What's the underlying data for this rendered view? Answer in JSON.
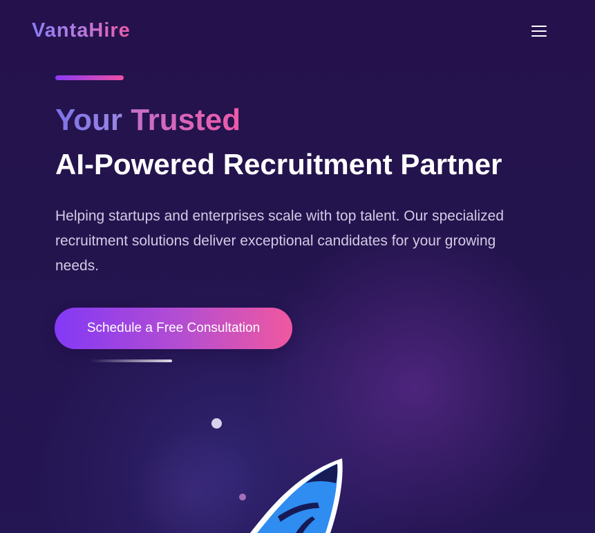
{
  "brand": {
    "name": "VantaHire"
  },
  "header": {
    "menu_icon": "hamburger-menu-icon"
  },
  "hero": {
    "headline_word_1": "Your",
    "headline_word_2": "Trusted",
    "headline_line_2": "AI-Powered Recruitment Partner",
    "description": "Helping startups and enterprises scale with top talent. Our specialized recruitment solutions deliver exceptional candidates for your growing needs.",
    "cta_label": "Schedule a Free Consultation",
    "illustration_icon": "rocket-icon"
  },
  "colors": {
    "background": "#24134c",
    "accent_purple": "#8339f5",
    "accent_pink": "#f0589f",
    "rocket_blue": "#2f8cf0",
    "text_light": "#d3cbe6"
  }
}
